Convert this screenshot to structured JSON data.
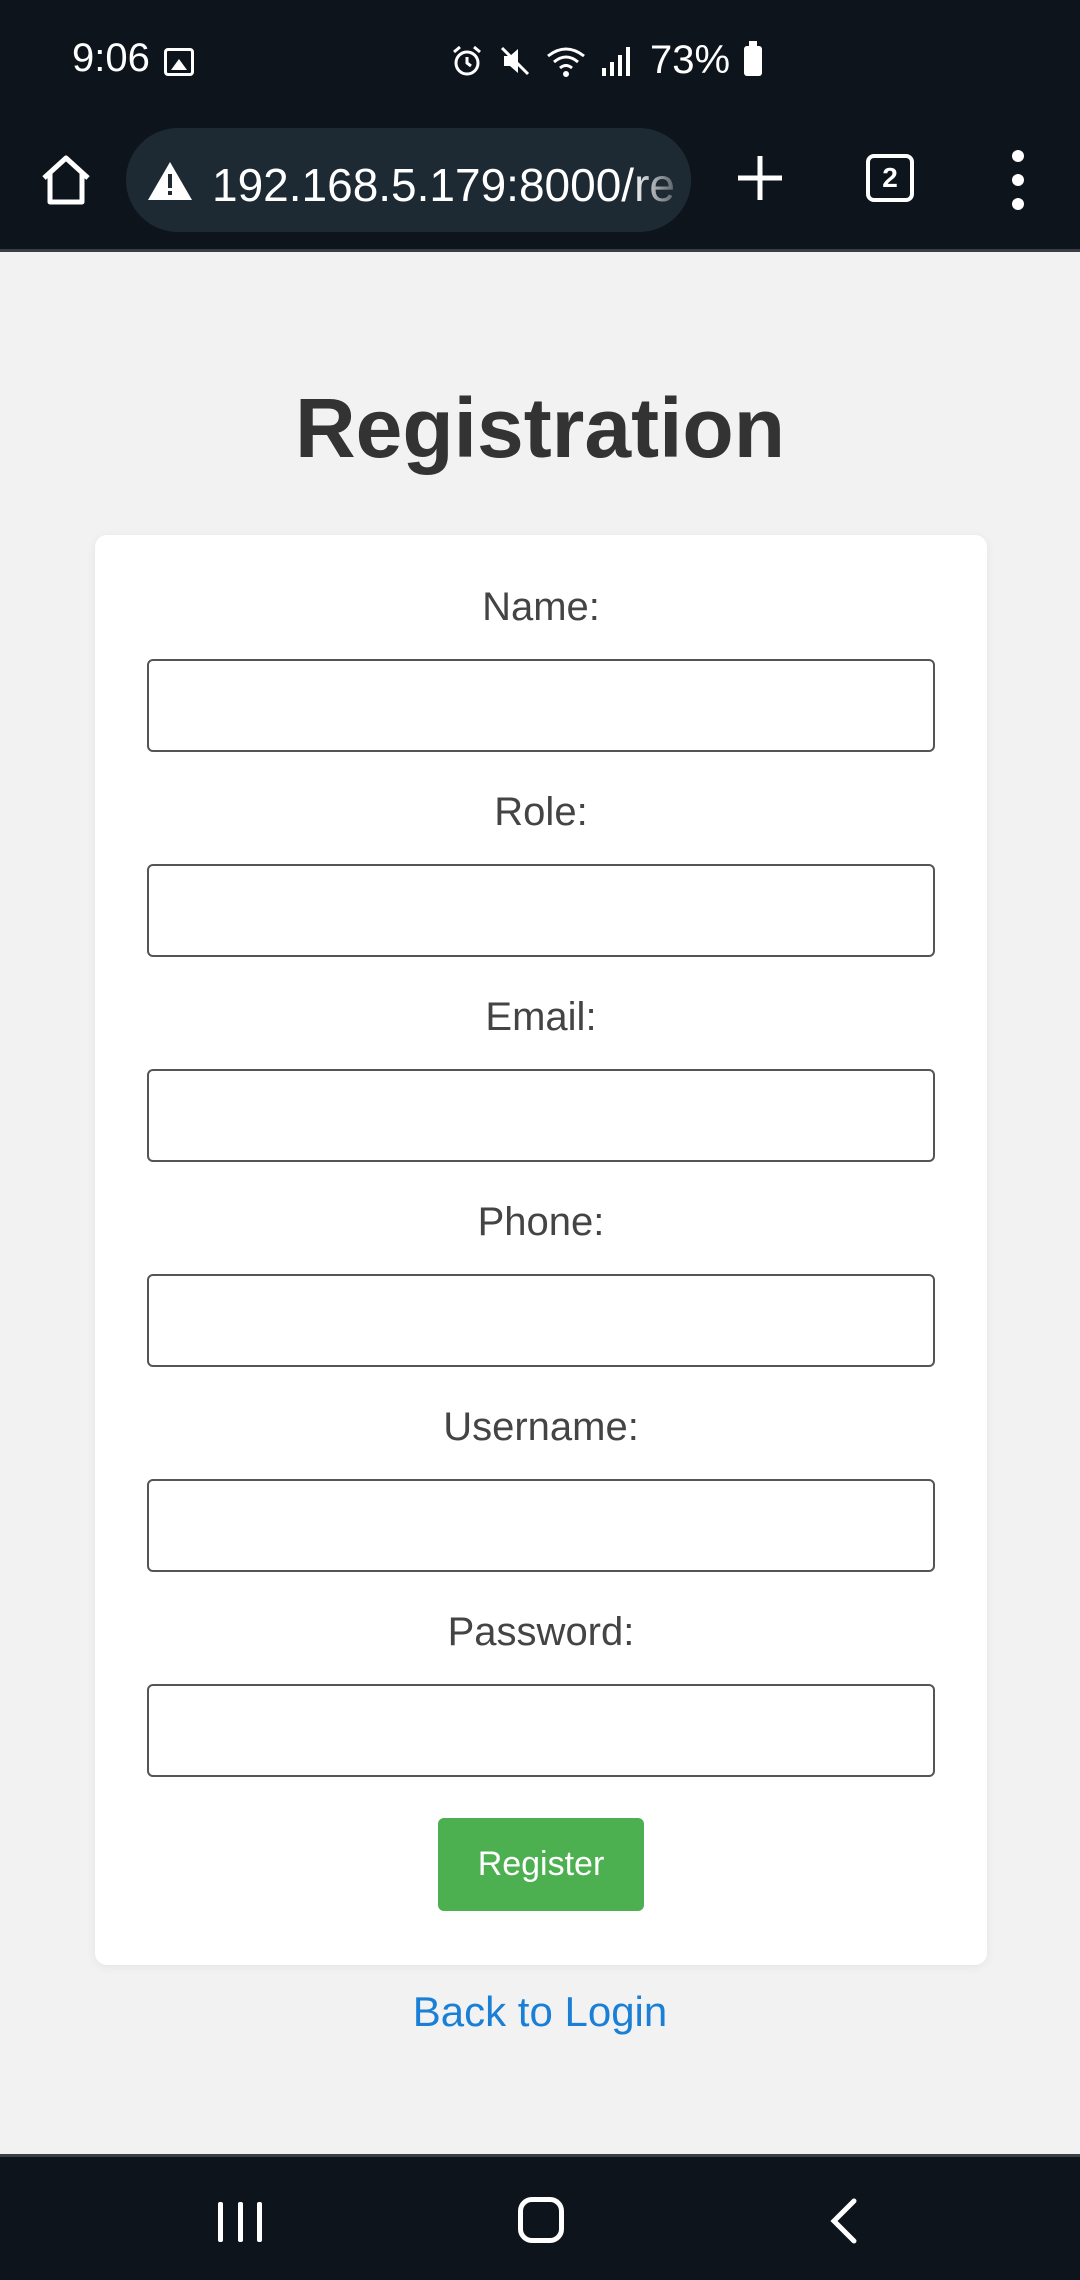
{
  "status_bar": {
    "time": "9:06",
    "battery": "73%",
    "icons": [
      "gallery-icon",
      "alarm-icon",
      "mute-icon",
      "wifi-icon",
      "signal-icon",
      "battery-icon"
    ]
  },
  "browser": {
    "url": "192.168.5.179:8000/re",
    "tab_count": "2"
  },
  "page": {
    "title": "Registration",
    "fields": [
      {
        "label": "Name:",
        "value": ""
      },
      {
        "label": "Role:",
        "value": ""
      },
      {
        "label": "Email:",
        "value": ""
      },
      {
        "label": "Phone:",
        "value": ""
      },
      {
        "label": "Username:",
        "value": ""
      },
      {
        "label": "Password:",
        "value": ""
      }
    ],
    "register_label": "Register",
    "back_link": "Back to Login"
  },
  "colors": {
    "accent_green": "#4caf50",
    "link_blue": "#1a7fd6",
    "chrome_dark": "#0e141b"
  }
}
